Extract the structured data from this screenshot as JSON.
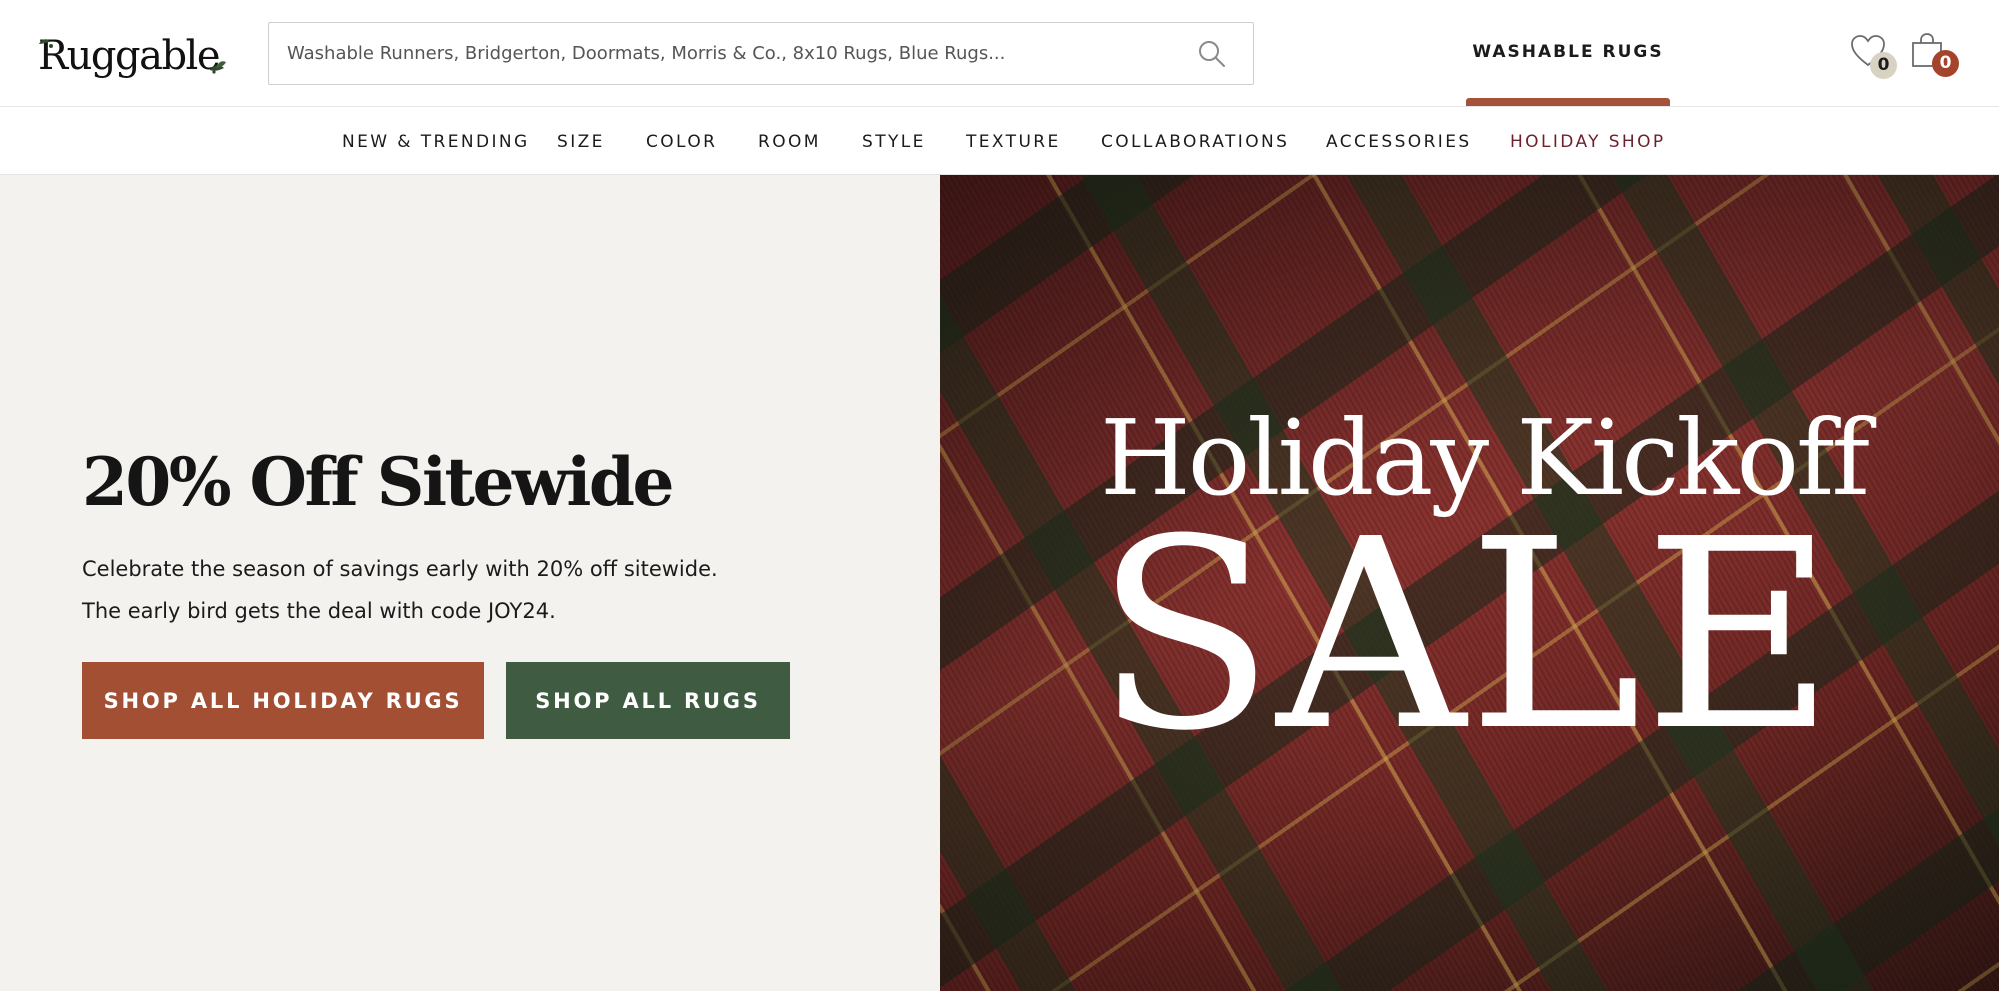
{
  "header": {
    "logo_text": "Ruggable",
    "search": {
      "placeholder": "Washable Runners, Bridgerton, Doormats, Morris & Co., 8x10 Rugs, Blue Rugs..."
    },
    "washable_tab_label": "WASHABLE RUGS",
    "wishlist_count": "0",
    "cart_count": "0"
  },
  "nav": {
    "items": [
      {
        "label": "NEW & TRENDING"
      },
      {
        "label": "SIZE"
      },
      {
        "label": "COLOR"
      },
      {
        "label": "ROOM"
      },
      {
        "label": "STYLE"
      },
      {
        "label": "TEXTURE"
      },
      {
        "label": "COLLABORATIONS"
      },
      {
        "label": "ACCESSORIES"
      },
      {
        "label": "HOLIDAY SHOP"
      }
    ]
  },
  "hero": {
    "headline": "20% Off Sitewide",
    "subline_1": "Celebrate the season of savings early with 20% off sitewide.",
    "subline_2": "The early bird gets the deal with code JOY24.",
    "cta_primary": "SHOP ALL HOLIDAY RUGS",
    "cta_secondary": "SHOP ALL RUGS",
    "banner_line_1": "Holiday Kickoff",
    "banner_line_2": "SALE"
  },
  "colors": {
    "accent_rust": "#a24f34",
    "accent_green": "#3f5b41",
    "holiday_nav": "#6e1f2b",
    "hero_bg": "#f4f2ef"
  },
  "icons": {
    "search": "search-icon",
    "wishlist": "heart-icon",
    "cart": "shopping-bag-icon",
    "logo_decoration": "holly-sprig-icon"
  }
}
